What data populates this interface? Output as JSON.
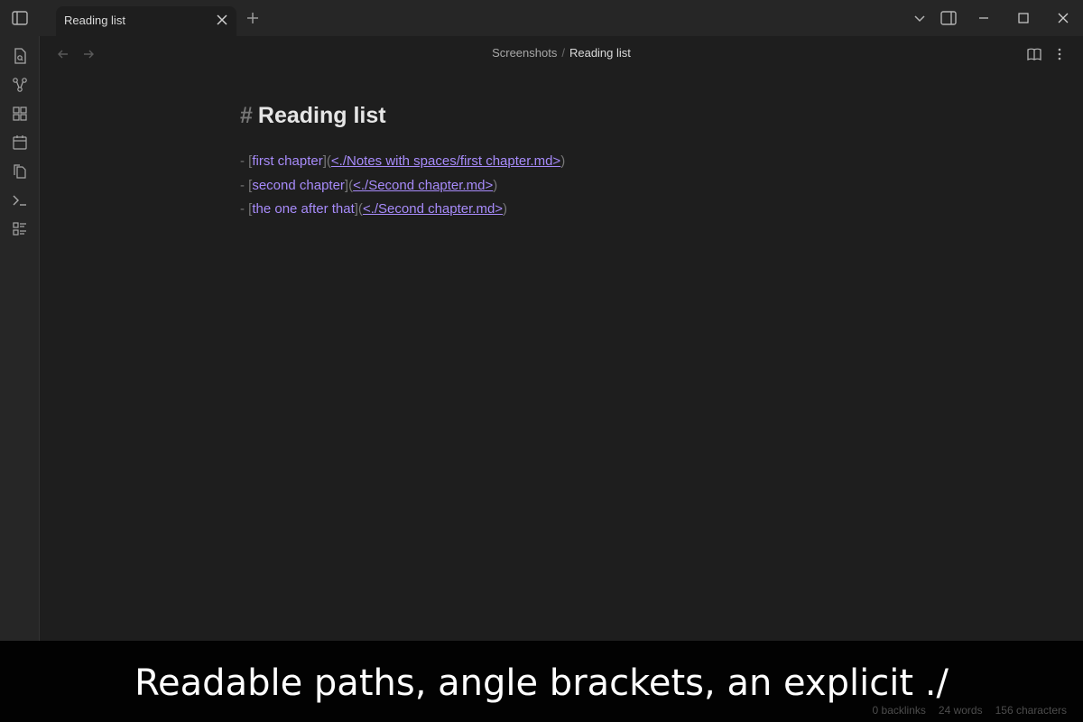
{
  "window": {
    "tab_title": "Reading list"
  },
  "breadcrumb": {
    "folder": "Screenshots",
    "separator": "/",
    "file": "Reading list"
  },
  "editor": {
    "heading_marker": "#",
    "heading": "Reading list",
    "list_items": [
      {
        "bullet": "- ",
        "open_bracket": "[",
        "text": "first chapter",
        "mid": "](",
        "url": "<./Notes with spaces/first chapter.md>",
        "close": ")"
      },
      {
        "bullet": "- ",
        "open_bracket": "[",
        "text": "second chapter",
        "mid": "](",
        "url": "<./Second chapter.md>",
        "close": ")"
      },
      {
        "bullet": "- ",
        "open_bracket": "[",
        "text": "the one after that",
        "mid": "](",
        "url": "<./Second chapter.md>",
        "close": ")"
      }
    ]
  },
  "status_bar": {
    "backlinks": "0 backlinks",
    "words": "24 words",
    "characters": "156 characters"
  },
  "caption": "Readable paths, angle brackets, an explicit ./",
  "colors": {
    "link": "#a78bfa",
    "background": "#1e1e1e",
    "chrome": "#262626"
  }
}
